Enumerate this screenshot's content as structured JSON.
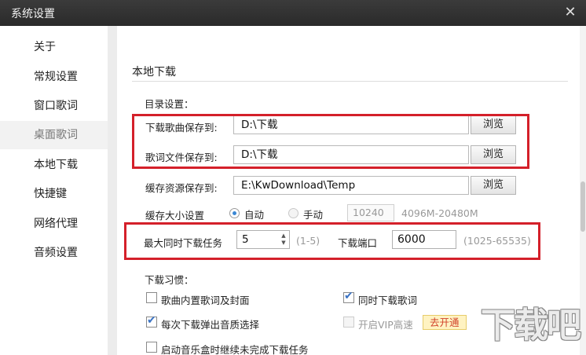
{
  "window": {
    "title": "系统设置",
    "close_glyph": "✕"
  },
  "sidebar": {
    "items": [
      {
        "label": "关于"
      },
      {
        "label": "常规设置"
      },
      {
        "label": "窗口歌词"
      },
      {
        "label": "桌面歌词",
        "active": true
      },
      {
        "label": "本地下载"
      },
      {
        "label": "快捷键"
      },
      {
        "label": "网络代理"
      },
      {
        "label": "音频设置"
      }
    ]
  },
  "section": {
    "title": "本地下载"
  },
  "directory": {
    "title": "目录设置：",
    "song": {
      "label": "下载歌曲保存到:",
      "value": "D:\\下载",
      "browse": "浏览"
    },
    "lyrics": {
      "label": "歌词文件保存到:",
      "value": "D:\\下载",
      "browse": "浏览"
    },
    "cache": {
      "label": "缓存资源保存到:",
      "value": "E:\\KwDownload\\Temp",
      "browse": "浏览"
    }
  },
  "cache_size": {
    "label": "缓存大小设置",
    "auto": {
      "label": "自动",
      "selected": true
    },
    "manual": {
      "label": "手动",
      "selected": false
    },
    "value": "10240",
    "range": "4096M-20480M"
  },
  "tasks": {
    "label": "最大同时下载任务",
    "value": "5",
    "range": "(1-5)",
    "port_label": "下载端口",
    "port_value": "6000",
    "port_range": "(1025-65535)"
  },
  "habits": {
    "title": "下载习惯：",
    "embed_lyrics": {
      "label": "歌曲内置歌词及封面",
      "checked": false
    },
    "download_lyrics": {
      "label": "同时下载歌词",
      "checked": true
    },
    "quality_popup": {
      "label": "每次下载弹出音质选择",
      "checked": true
    },
    "vip_speed": {
      "label": "开启VIP高速",
      "checked": false,
      "disabled": true,
      "badge": "去开通"
    },
    "resume": {
      "label": "启动音乐盒时继续未完成下载任务",
      "checked": false
    }
  },
  "watermark": {
    "text": "下载吧"
  },
  "colors": {
    "highlight_border": "#d4202a",
    "titlebar": "#333333",
    "check_blue": "#3a73c4"
  }
}
